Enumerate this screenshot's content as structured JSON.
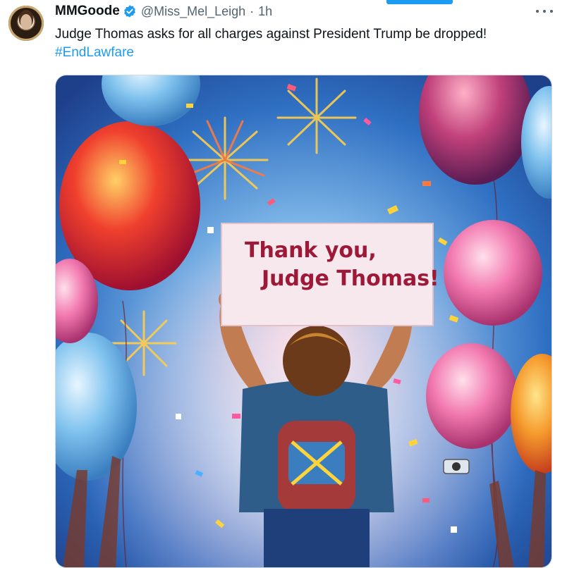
{
  "window": {
    "active_indicator_color": "#1d9bf0"
  },
  "tweet": {
    "display_name": "MMGoode",
    "handle": "@Miss_Mel_Leigh",
    "separator": "·",
    "timestamp": "1h",
    "verified_icon": "verified-badge-icon",
    "more_icon": "more-options-icon",
    "text": "Judge Thomas asks for all charges against President Trump be dropped!",
    "hashtag": "#EndLawfare",
    "link_color": "#1d9bf0"
  },
  "media": {
    "sign_line1": "Thank you,",
    "sign_line2": "Judge Thomas!"
  }
}
